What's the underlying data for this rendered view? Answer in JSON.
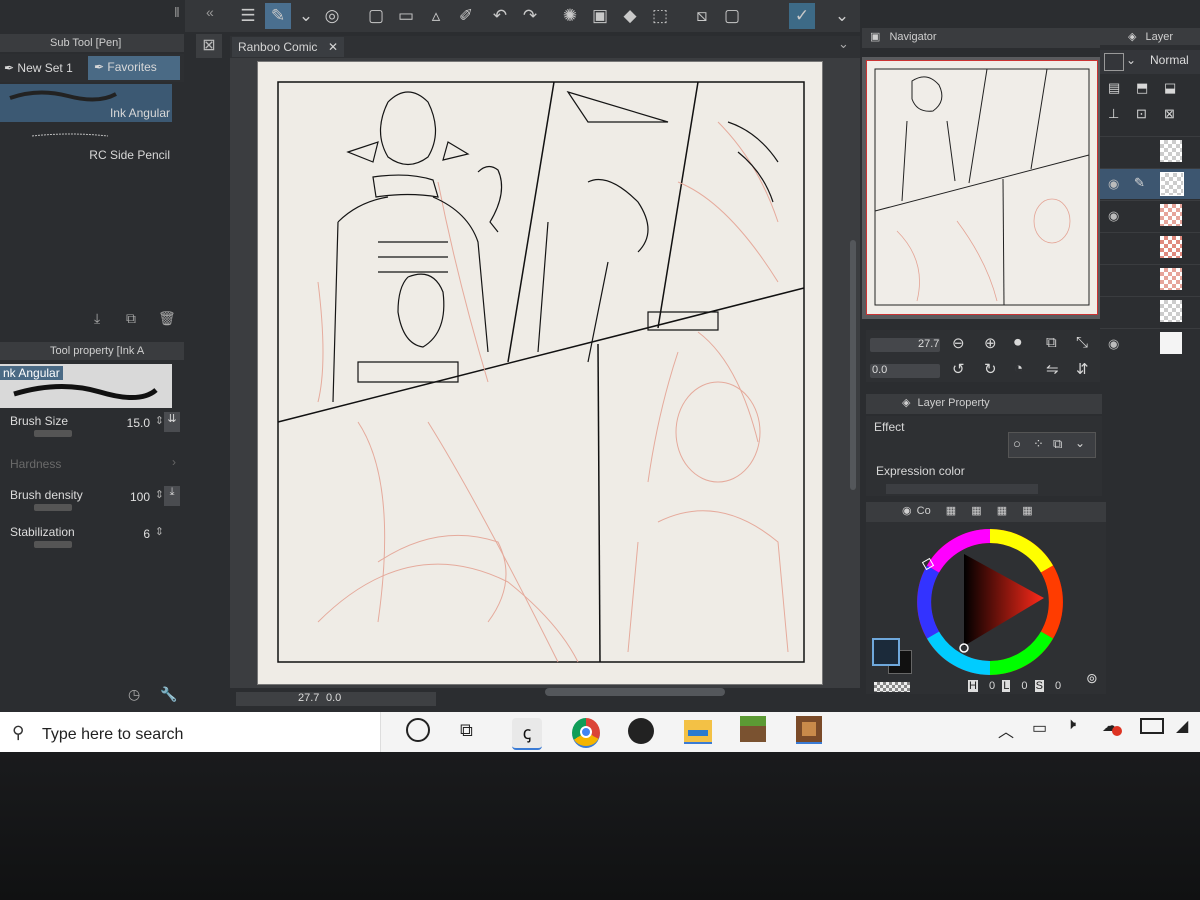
{
  "toolbar": {
    "icons": [
      "menu-icon",
      "pen-tool-icon",
      "chevron-down-icon",
      "spiral-icon",
      "new-file-icon",
      "open-folder-icon",
      "save-icon",
      "pen-alt-icon",
      "undo-icon",
      "redo-icon",
      "loading-icon",
      "clear-icon",
      "fill-icon",
      "transform-icon",
      "select-off-icon",
      "frame-icon",
      "check-icon",
      "chevron-down-icon"
    ]
  },
  "canvas": {
    "tab_label": "Ranboo Comic",
    "tab_close": "✕",
    "zoom_value": "27.7",
    "rotation_value": "0.0"
  },
  "sub_tool": {
    "title": "Sub Tool [Pen]",
    "tabs": [
      {
        "label": "New Set 1",
        "active": false
      },
      {
        "label": "Favorites",
        "active": true
      }
    ],
    "brushes": [
      {
        "label": "Ink Angular",
        "selected": true
      },
      {
        "label": "RC Side Pencil",
        "selected": false
      }
    ]
  },
  "tool_property": {
    "title": "Tool property [Ink A",
    "brush_preview_label": "nk Angular",
    "properties": [
      {
        "label": "Brush Size",
        "value": "15.0",
        "enabled": true
      },
      {
        "label": "Hardness",
        "value": "",
        "enabled": false
      },
      {
        "label": "Brush density",
        "value": "100",
        "enabled": true
      },
      {
        "label": "Stabilization",
        "value": "6",
        "enabled": true
      }
    ]
  },
  "navigator": {
    "title": "Navigator",
    "zoom_value": "27.7",
    "rotation_value": "0.0"
  },
  "layer_panel": {
    "title": "Layer",
    "blend_mode": "Normal",
    "layer_rows": [
      {
        "visible": false,
        "editing": false,
        "thumb": "checker"
      },
      {
        "visible": true,
        "editing": true,
        "thumb": "checker"
      },
      {
        "visible": true,
        "editing": false,
        "thumb": "red"
      },
      {
        "visible": false,
        "editing": false,
        "thumb": "red"
      },
      {
        "visible": false,
        "editing": false,
        "thumb": "red"
      },
      {
        "visible": false,
        "editing": false,
        "thumb": "checker"
      },
      {
        "visible": true,
        "editing": false,
        "thumb": "white"
      }
    ]
  },
  "layer_property": {
    "title": "Layer Property",
    "effect_label": "Effect",
    "expression_color_label": "Expression color"
  },
  "color_wheel": {
    "title": "Co",
    "hsv_labels": [
      "H",
      "L",
      "S"
    ],
    "hsv_values": [
      "0",
      "0",
      "0"
    ],
    "main_color": "#111111",
    "sub_color": "#2a2a2a"
  },
  "taskbar": {
    "search_placeholder": "Type here to search",
    "apps": [
      "cortana-icon",
      "task-view-icon",
      "clip-studio-icon",
      "chrome-icon",
      "obs-icon",
      "file-explorer-icon",
      "minecraft-icon",
      "minecraft-dungeons-icon"
    ]
  }
}
